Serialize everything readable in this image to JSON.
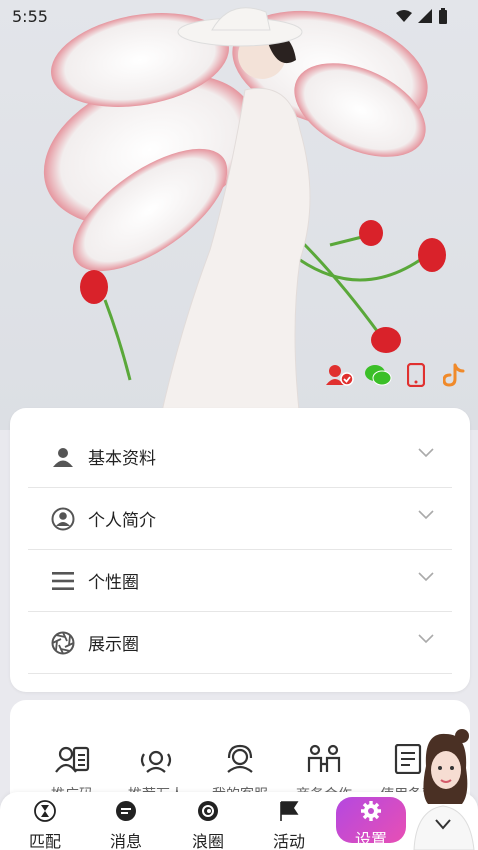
{
  "status": {
    "time": "5:55"
  },
  "social": [
    "add-friend-icon",
    "wechat-icon",
    "phone-icon",
    "tiktok-icon"
  ],
  "profile_sections": [
    {
      "label": "基本资料",
      "icon": "person-icon"
    },
    {
      "label": "个人简介",
      "icon": "user-circle-icon"
    },
    {
      "label": "个性圈",
      "icon": "list-icon"
    },
    {
      "label": "展示圈",
      "icon": "aperture-icon"
    }
  ],
  "tools": [
    {
      "label": "推广码",
      "icon": "person-card-icon"
    },
    {
      "label": "推荐万人",
      "icon": "group-icon"
    },
    {
      "label": "我的客服",
      "icon": "headset-icon"
    },
    {
      "label": "商务合作",
      "icon": "partners-icon"
    },
    {
      "label": "使用条款",
      "icon": "document-icon"
    }
  ],
  "nav": [
    {
      "label": "匹配",
      "icon": "hourglass-icon"
    },
    {
      "label": "消息",
      "icon": "chat-icon"
    },
    {
      "label": "浪圈",
      "icon": "swirl-icon"
    },
    {
      "label": "活动",
      "icon": "flag-icon"
    },
    {
      "label": "设置",
      "icon": "gear-icon",
      "active": true
    }
  ],
  "colors": {
    "accent_start": "#b448e0",
    "accent_end": "#e84fb4",
    "rose": "#d9222a"
  }
}
